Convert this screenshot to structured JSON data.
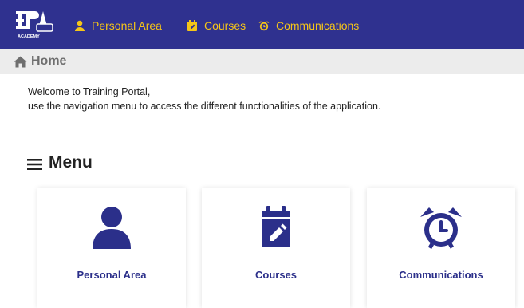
{
  "header": {
    "logo_text": "EPA ACADEMY",
    "nav": [
      {
        "label": "Personal Area",
        "icon": "user-icon"
      },
      {
        "label": "Courses",
        "icon": "calendar-edit-icon"
      },
      {
        "label": "Communications",
        "icon": "alarm-clock-icon"
      }
    ]
  },
  "breadcrumb": {
    "icon": "home-icon",
    "label": "Home"
  },
  "welcome": {
    "line1": "Welcome to Training Portal,",
    "line2": "use the navigation menu to access the different functionalities of the application."
  },
  "menu": {
    "icon": "hamburger-icon",
    "title": "Menu",
    "cards": [
      {
        "label": "Personal Area",
        "icon": "user-icon"
      },
      {
        "label": "Courses",
        "icon": "calendar-edit-icon"
      },
      {
        "label": "Communications",
        "icon": "alarm-clock-icon"
      }
    ]
  },
  "colors": {
    "header_bg": "#2f318f",
    "nav_text": "#f5c518",
    "card_icon": "#2b2f8a",
    "breadcrumb_bg": "#ececec"
  }
}
